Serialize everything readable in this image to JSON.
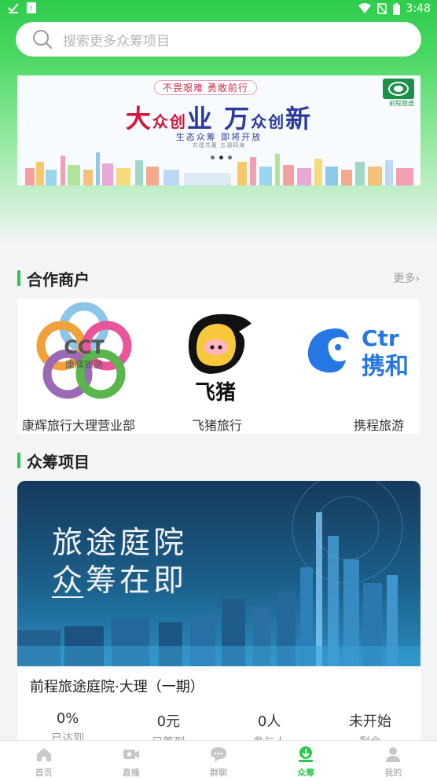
{
  "status_bar": {
    "time": "3:48",
    "icons": [
      "check-download-icon",
      "sim-alert-icon",
      "wifi-icon",
      "no-sim-icon",
      "battery-icon"
    ]
  },
  "search": {
    "placeholder": "搜索更多众筹项目"
  },
  "banner": {
    "tag": "不畏艰难 勇敢前行",
    "title_parts": [
      "大",
      "众创",
      "业",
      " 万",
      "众创",
      "新"
    ],
    "subtitle": "生态众筹 即将开放",
    "subtitle_small": "共建共赢    五湖四海",
    "logo_text": "前程旅途",
    "dot_count": 3,
    "active_dot": 1
  },
  "partners_section": {
    "title": "合作商户",
    "more": "更多›",
    "items": [
      {
        "name": "康辉旅行大理营业部",
        "logo_text": "CCT",
        "logo_sub": "康辉旅游",
        "logo": "cct-logo-icon"
      },
      {
        "name": "飞猪旅行",
        "logo_text": "飞猪",
        "logo": "fliggy-logo-icon"
      },
      {
        "name": "携程旅游",
        "logo_text": "Ctr",
        "logo_sub": "携和",
        "logo": "ctrip-logo-icon"
      }
    ]
  },
  "projects_section": {
    "title": "众筹项目",
    "items": [
      {
        "image_title_line1": "旅途庭院",
        "image_title_line2": "众筹在即",
        "name": "前程旅途庭院·大理（一期）",
        "stats": [
          {
            "value": "0%",
            "label": "已达到"
          },
          {
            "value": "0元",
            "label": "已筹到"
          },
          {
            "value": "0人",
            "label": "参与人"
          },
          {
            "value": "未开始",
            "label": "剩余"
          }
        ]
      }
    ]
  },
  "bottom_nav": {
    "active": 3,
    "items": [
      {
        "label": "首页",
        "icon": "home-icon"
      },
      {
        "label": "直播",
        "icon": "video-icon"
      },
      {
        "label": "群聊",
        "icon": "chat-icon"
      },
      {
        "label": "众筹",
        "icon": "crowdfund-icon"
      },
      {
        "label": "我的",
        "icon": "user-icon"
      }
    ]
  },
  "colors": {
    "accent": "#2cc84c",
    "top_green": "#2fcc4d"
  }
}
